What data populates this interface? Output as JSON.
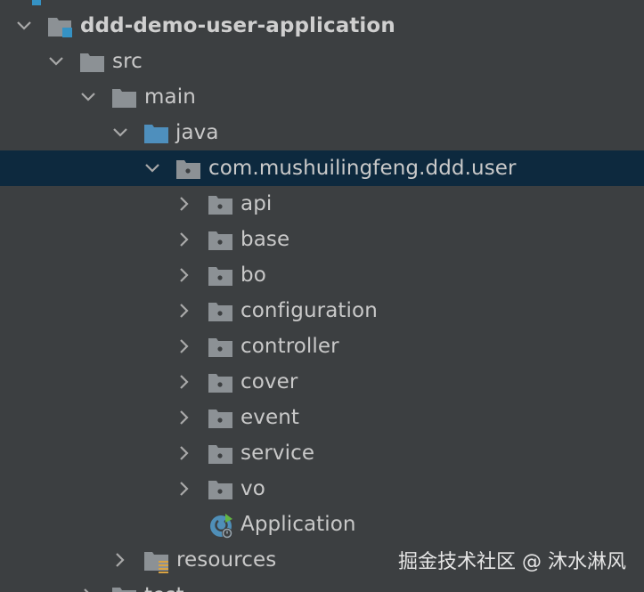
{
  "tree": {
    "root": {
      "label": "ddd-demo-user-application",
      "expanded": true,
      "icon": "module-folder-icon"
    },
    "src": {
      "label": "src",
      "expanded": true,
      "icon": "folder-icon"
    },
    "main": {
      "label": "main",
      "expanded": true,
      "icon": "folder-icon"
    },
    "java": {
      "label": "java",
      "expanded": true,
      "icon": "source-root-folder-icon"
    },
    "package": {
      "label": "com.mushuilingfeng.ddd.user",
      "expanded": true,
      "selected": true,
      "icon": "package-icon"
    },
    "children": [
      {
        "label": "api",
        "icon": "package-icon"
      },
      {
        "label": "base",
        "icon": "package-icon"
      },
      {
        "label": "bo",
        "icon": "package-icon"
      },
      {
        "label": "configuration",
        "icon": "package-icon"
      },
      {
        "label": "controller",
        "icon": "package-icon"
      },
      {
        "label": "cover",
        "icon": "package-icon"
      },
      {
        "label": "event",
        "icon": "package-icon"
      },
      {
        "label": "service",
        "icon": "package-icon"
      },
      {
        "label": "vo",
        "icon": "package-icon"
      }
    ],
    "application": {
      "label": "Application",
      "icon": "spring-boot-class-icon"
    },
    "resources": {
      "label": "resources",
      "expanded": false,
      "icon": "resources-folder-icon"
    },
    "test_partial": {
      "label": "test"
    }
  },
  "watermark": "掘金技术社区 @ 沐水淋风",
  "colors": {
    "background": "#3c3f41",
    "selection": "#0d293e",
    "text": "#c9c9c9",
    "folder": "#8c9195",
    "source_root": "#4e8fbd",
    "accent_blue": "#3592c4"
  }
}
